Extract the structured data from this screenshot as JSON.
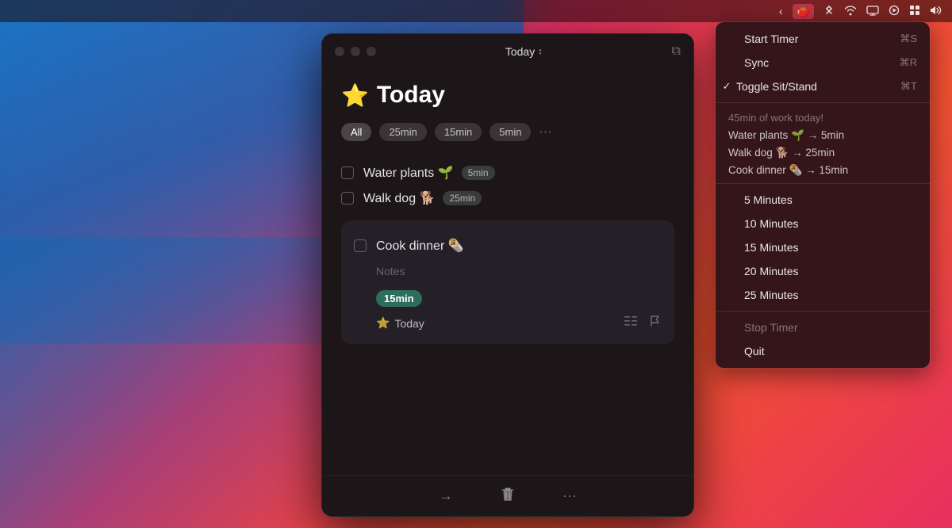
{
  "desktop": {
    "bg_desc": "macOS Big Sur gradient background"
  },
  "menubar": {
    "icons": [
      "chevron-left",
      "tomato-app",
      "bluetooth",
      "wifi",
      "display",
      "play",
      "grid",
      "volume"
    ]
  },
  "window": {
    "title": "Today",
    "title_arrow": "↕",
    "page_title_emoji": "⭐",
    "page_title": "Today",
    "filters": [
      "All",
      "25min",
      "15min",
      "5min",
      "..."
    ],
    "tasks": [
      {
        "label": "Water plants 🌱",
        "badge": "5min",
        "checked": false
      },
      {
        "label": "Walk dog 🐕",
        "badge": "25min",
        "checked": false
      }
    ],
    "card_task": {
      "label": "Cook dinner 🌯",
      "notes": "Notes",
      "time_badge": "15min",
      "today_label": "⭐ Today"
    },
    "bottombar": {
      "arrow_icon": "→",
      "trash_icon": "🗑",
      "dots_icon": "···"
    }
  },
  "dropdown": {
    "items": [
      {
        "type": "item",
        "label": "Start Timer",
        "shortcut": "⌘S",
        "checked": false
      },
      {
        "type": "item",
        "label": "Sync",
        "shortcut": "⌘R",
        "checked": false
      },
      {
        "type": "item",
        "label": "Toggle Sit/Stand",
        "shortcut": "⌘T",
        "checked": true
      },
      {
        "type": "separator"
      },
      {
        "type": "header",
        "label": "45min of work today!"
      },
      {
        "type": "summary",
        "label": "Water plants 🌱 → 5min"
      },
      {
        "type": "summary",
        "label": "Walk dog 🐕 → 25min"
      },
      {
        "type": "summary",
        "label": "Cook dinner 🌯 → 15min"
      },
      {
        "type": "separator"
      },
      {
        "type": "item",
        "label": "5 Minutes",
        "checked": false
      },
      {
        "type": "item",
        "label": "10 Minutes",
        "checked": false
      },
      {
        "type": "item",
        "label": "15 Minutes",
        "checked": false
      },
      {
        "type": "item",
        "label": "20 Minutes",
        "checked": false
      },
      {
        "type": "item",
        "label": "25 Minutes",
        "checked": false
      },
      {
        "type": "separator"
      },
      {
        "type": "item",
        "label": "Stop Timer",
        "disabled": true,
        "checked": false
      },
      {
        "type": "item",
        "label": "Quit",
        "checked": false
      }
    ]
  }
}
